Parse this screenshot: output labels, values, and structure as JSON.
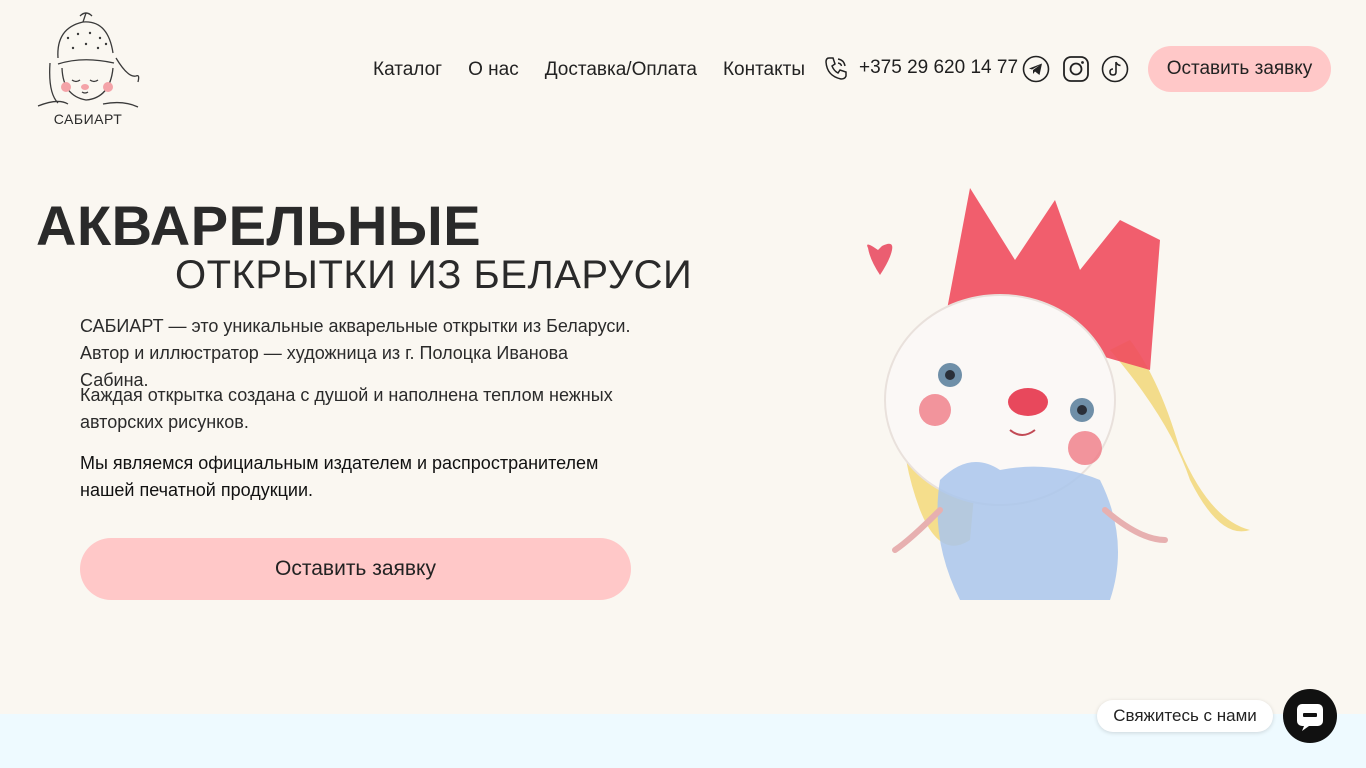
{
  "brand": {
    "logo_text": "САБИАРТ"
  },
  "nav": {
    "items": [
      "Каталог",
      "О нас",
      "Доставка/Оплата",
      "Контакты"
    ]
  },
  "header": {
    "phone": "+375 29 620 14 77",
    "social_icons": [
      "telegram-icon",
      "instagram-icon",
      "tiktok-icon"
    ],
    "request_button": "Оставить заявку"
  },
  "hero": {
    "title_line1": "АКВАРЕЛЬНЫЕ",
    "title_line2": "ОТКРЫТКИ ИЗ БЕЛАРУСИ",
    "p1": "САБИАРТ — это уникальные акварельные открытки из Беларуси. Автор и иллюстратор — художница из г. Полоцка Иванова Сабина.",
    "p2": "Каждая открытка создана с душой и наполнена теплом нежных авторских рисунков.",
    "p3": "Мы являемся официальным издателем и распространителем нашей печатной продукции.",
    "cta": "Оставить заявку"
  },
  "widget": {
    "contact_label": "Свяжитесь с нами"
  },
  "colors": {
    "background": "#faf7f1",
    "button": "#ffc8c8",
    "band": "#eefaff",
    "chat": "#111111"
  }
}
